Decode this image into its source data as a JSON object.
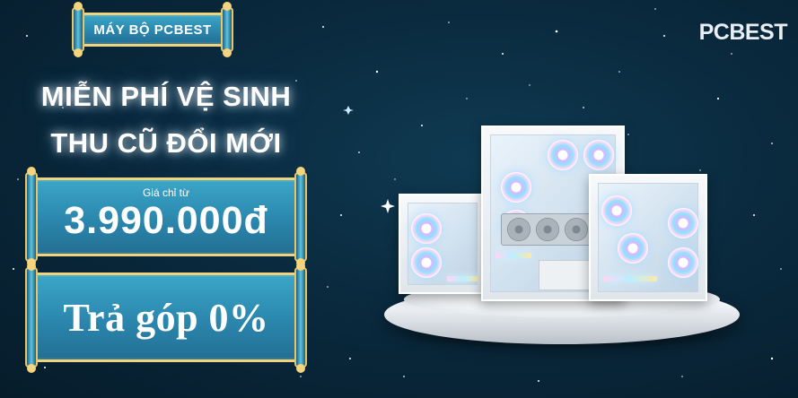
{
  "tag": {
    "label": "MÁY BỘ PCBEST"
  },
  "headline": {
    "line1": "MIỄN PHÍ VỆ SINH",
    "line2": "THU CŨ ĐỔI MỚI"
  },
  "price": {
    "label": "Giá chỉ từ",
    "value": "3.990.000đ"
  },
  "installment": {
    "label": "Trả góp 0%"
  },
  "brand": {
    "logo_text": "PCBEST"
  },
  "colors": {
    "background": "#0a2a3e",
    "scroll_body": "#2b86ad",
    "scroll_trim": "#f2d27a",
    "text": "#ffffff"
  }
}
